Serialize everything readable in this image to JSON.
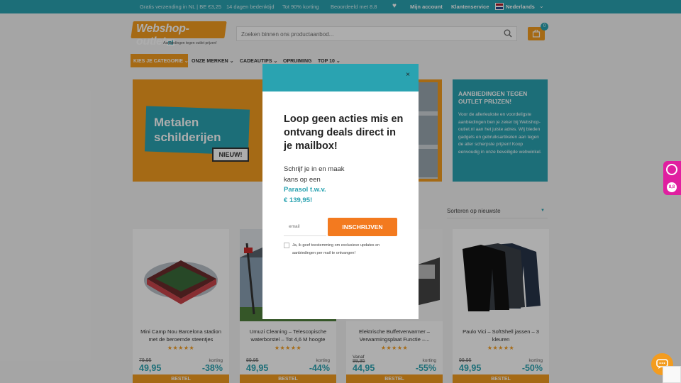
{
  "topbar": {
    "items": [
      "Gratis verzending in NL | BE €3,25",
      "14 dagen bedenktijd",
      "Tot 90% korting",
      "Beoordeeld met 8.8"
    ],
    "account": "Mijn account",
    "service": "Klantenservice",
    "language": "Nederlands"
  },
  "header": {
    "logo_text": "Webshop-outlet",
    "logo_suffix": "nl",
    "logo_tagline": "Aanbiedingen tegen outlet prijzen!",
    "search_placeholder": "Zoeken binnen ons productaanbod...",
    "cart_count": "0"
  },
  "nav": {
    "category": "KIES JE CATEGORIE",
    "items": [
      "ONZE MERKEN",
      "CADEAUTIPS",
      "OPRUIMING",
      "TOP 10"
    ]
  },
  "banner": {
    "title_line1": "Metalen",
    "title_line2": "schilderijen",
    "badge": "NIEUW!"
  },
  "promo": {
    "title": "AANBIEDINGEN TEGEN OUTLET PRIJZEN!",
    "body": "Voor de allerleukste en voordeligste aanbiedingen ben je zeker bij Webshop-outlet.nl aan het juiste adres. Wij bieden gadgets en gebruiksartikelen aan tegen de aller scherpste prijzen! Koop eenvoudig in onze beveiligde webwinkel."
  },
  "sort": {
    "selected": "Sorteren op nieuwste"
  },
  "products": [
    {
      "name": "Mini Camp Nou Barcelona stadion met de beroemde steentjes",
      "old": "79,95",
      "new": "49,95",
      "korting": "korting",
      "pct": "-38%",
      "vanaf": "",
      "buy": "BESTEL"
    },
    {
      "name": "Umuzi Cleaning – Telescopische waterborstel – Tot 4,6 M hoogte",
      "old": "89,95",
      "new": "49,95",
      "korting": "korting",
      "pct": "-44%",
      "vanaf": "",
      "buy": "BESTEL"
    },
    {
      "name": "Elektrische Buffetverwarmer – Verwarmingsplaat Functie –...",
      "old": "99,95",
      "new": "44,95",
      "korting": "korting",
      "pct": "-55%",
      "vanaf": "Vanaf",
      "buy": "BESTEL"
    },
    {
      "name": "Paulo Vici – SoftShell jassen – 3 kleuren",
      "old": "99,95",
      "new": "49,95",
      "korting": "korting",
      "pct": "-50%",
      "vanaf": "",
      "buy": "BESTEL"
    }
  ],
  "modal": {
    "heading": "Loop geen acties mis en ontvang deals direct in je mailbox!",
    "line1": "Schrijf je in en maak",
    "line2": "kans op een",
    "line3": "Parasol t.w.v.",
    "line4": "€ 139,95!",
    "email_placeholder": "email",
    "submit": "INSCHRIJVEN",
    "consent": "Ja, ik geef toestemming om exclusieve updates en aanbiedingen per mail te ontvangen!",
    "close": "×"
  },
  "widgets": {
    "rating": "8,8"
  },
  "colors": {
    "teal": "#2aa3b1",
    "orange": "#f39c1f",
    "submit": "#f37a1f",
    "kiyoh": "#e01fa0"
  }
}
